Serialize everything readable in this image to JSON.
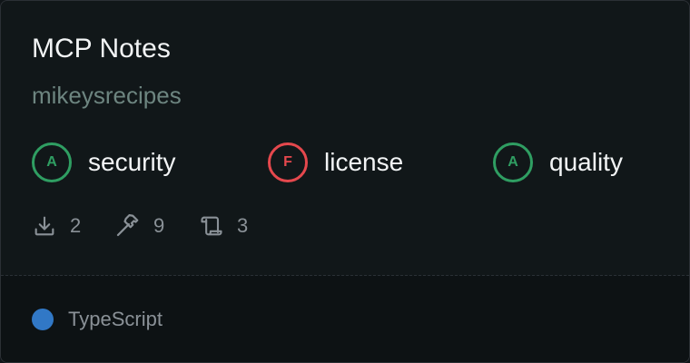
{
  "card": {
    "title": "MCP Notes",
    "owner": "mikeysrecipes"
  },
  "grades": [
    {
      "letter": "A",
      "label": "security",
      "status": "pass"
    },
    {
      "letter": "F",
      "label": "license",
      "status": "fail"
    },
    {
      "letter": "A",
      "label": "quality",
      "status": "pass"
    }
  ],
  "stats": {
    "downloads": "2",
    "tools": "9",
    "resources": "3",
    "icons": [
      "download-icon",
      "hammer-icon",
      "scroll-icon"
    ]
  },
  "language": {
    "name": "TypeScript",
    "color": "#3178c6"
  },
  "colors": {
    "pass": "#2f9e62",
    "fail": "#e5484d"
  }
}
